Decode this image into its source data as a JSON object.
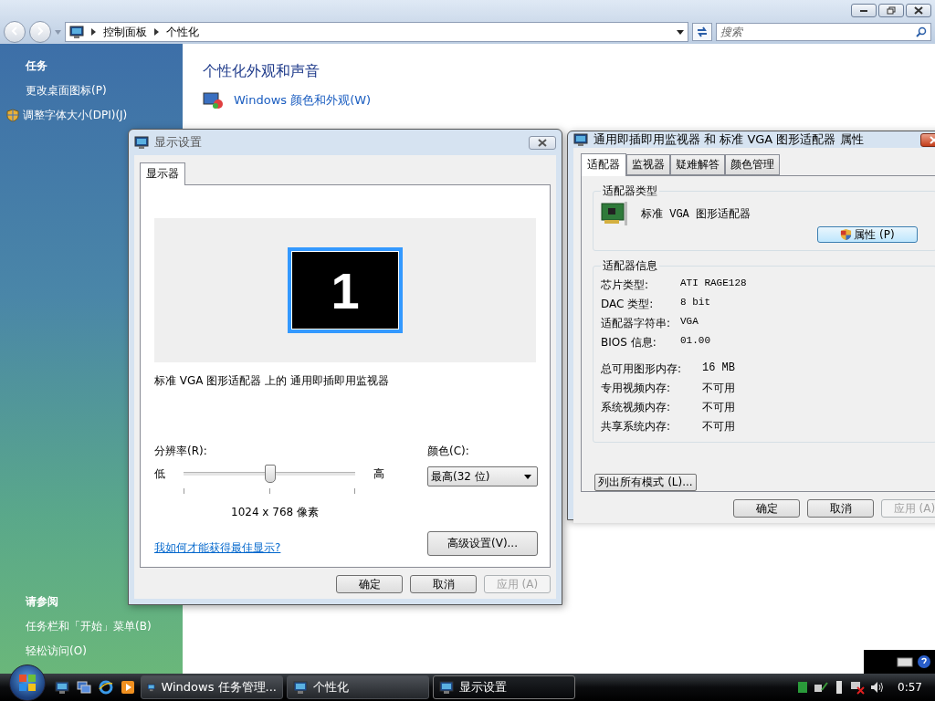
{
  "explorer": {
    "breadcrumb": [
      "控制面板",
      "个性化"
    ],
    "search": {
      "placeholder": "搜索"
    },
    "sidebar": {
      "tasks_heading": "任务",
      "tasks": [
        {
          "label": "更改桌面图标(P)",
          "kind": "plain"
        },
        {
          "label": "调整字体大小(DPI)(J)",
          "kind": "shield"
        }
      ],
      "see_also_heading": "请参阅",
      "see_also": [
        "任务栏和「开始」菜单(B)",
        "轻松访问(O)"
      ]
    },
    "content": {
      "heading": "个性化外观和声音",
      "links": [
        "Windows 颜色和外观(W)"
      ]
    }
  },
  "display_settings": {
    "title": "显示设置",
    "active": false,
    "tabs": [
      {
        "label": "显示器",
        "selected": true
      }
    ],
    "monitor_number": "1",
    "monitor_description": "标准 VGA 图形适配器 上的 通用即插即用监视器",
    "resolution_label": "分辨率(R):",
    "low": "低",
    "high": "高",
    "resolution": {
      "level": 0.5
    },
    "resolution_text": "1024 x 768 像素",
    "color_label": "颜色(C):",
    "color_value": "最高(32 位)",
    "help_link": "我如何才能获得最佳显示?",
    "advanced_button": "高级设置(V)...",
    "buttons": [
      {
        "label": "确定",
        "disabled": false
      },
      {
        "label": "取消",
        "disabled": false
      },
      {
        "label": "应用 (A)",
        "disabled": true
      }
    ]
  },
  "properties": {
    "title": "通用即插即用监视器 和 标准 VGA 图形适配器 属性",
    "active": true,
    "tabs": [
      {
        "label": "适配器",
        "selected": true
      },
      {
        "label": "监视器",
        "selected": false
      },
      {
        "label": "疑难解答",
        "selected": false
      },
      {
        "label": "颜色管理",
        "selected": false
      }
    ],
    "adapter_type": {
      "heading": "适配器类型",
      "name": "标准 VGA 图形适配器",
      "button": "属性 (P)"
    },
    "adapter_info": {
      "heading": "适配器信息",
      "groups": [
        [
          {
            "label": "芯片类型:",
            "value": "ATI RAGE128"
          },
          {
            "label": "DAC 类型:",
            "value": "8 bit"
          },
          {
            "label": "适配器字符串:",
            "value": "VGA"
          },
          {
            "label": "BIOS 信息:",
            "value": "01.00"
          }
        ],
        [
          {
            "label": "总可用图形内存:",
            "value": "16 MB"
          },
          {
            "label": "专用视频内存:",
            "value": "不可用"
          },
          {
            "label": "系统视频内存:",
            "value": "不可用"
          },
          {
            "label": "共享系统内存:",
            "value": "不可用"
          }
        ]
      ]
    },
    "list_modes_button": "列出所有模式 (L)...",
    "buttons": [
      {
        "label": "确定",
        "disabled": false
      },
      {
        "label": "取消",
        "disabled": false
      },
      {
        "label": "应用 (A)",
        "disabled": true
      }
    ]
  },
  "taskbar": {
    "tasks": [
      {
        "label": "Windows 任务管理...",
        "selected": false
      },
      {
        "label": "个性化",
        "selected": false
      },
      {
        "label": "显示设置",
        "selected": true
      }
    ],
    "clock": "0:57"
  }
}
